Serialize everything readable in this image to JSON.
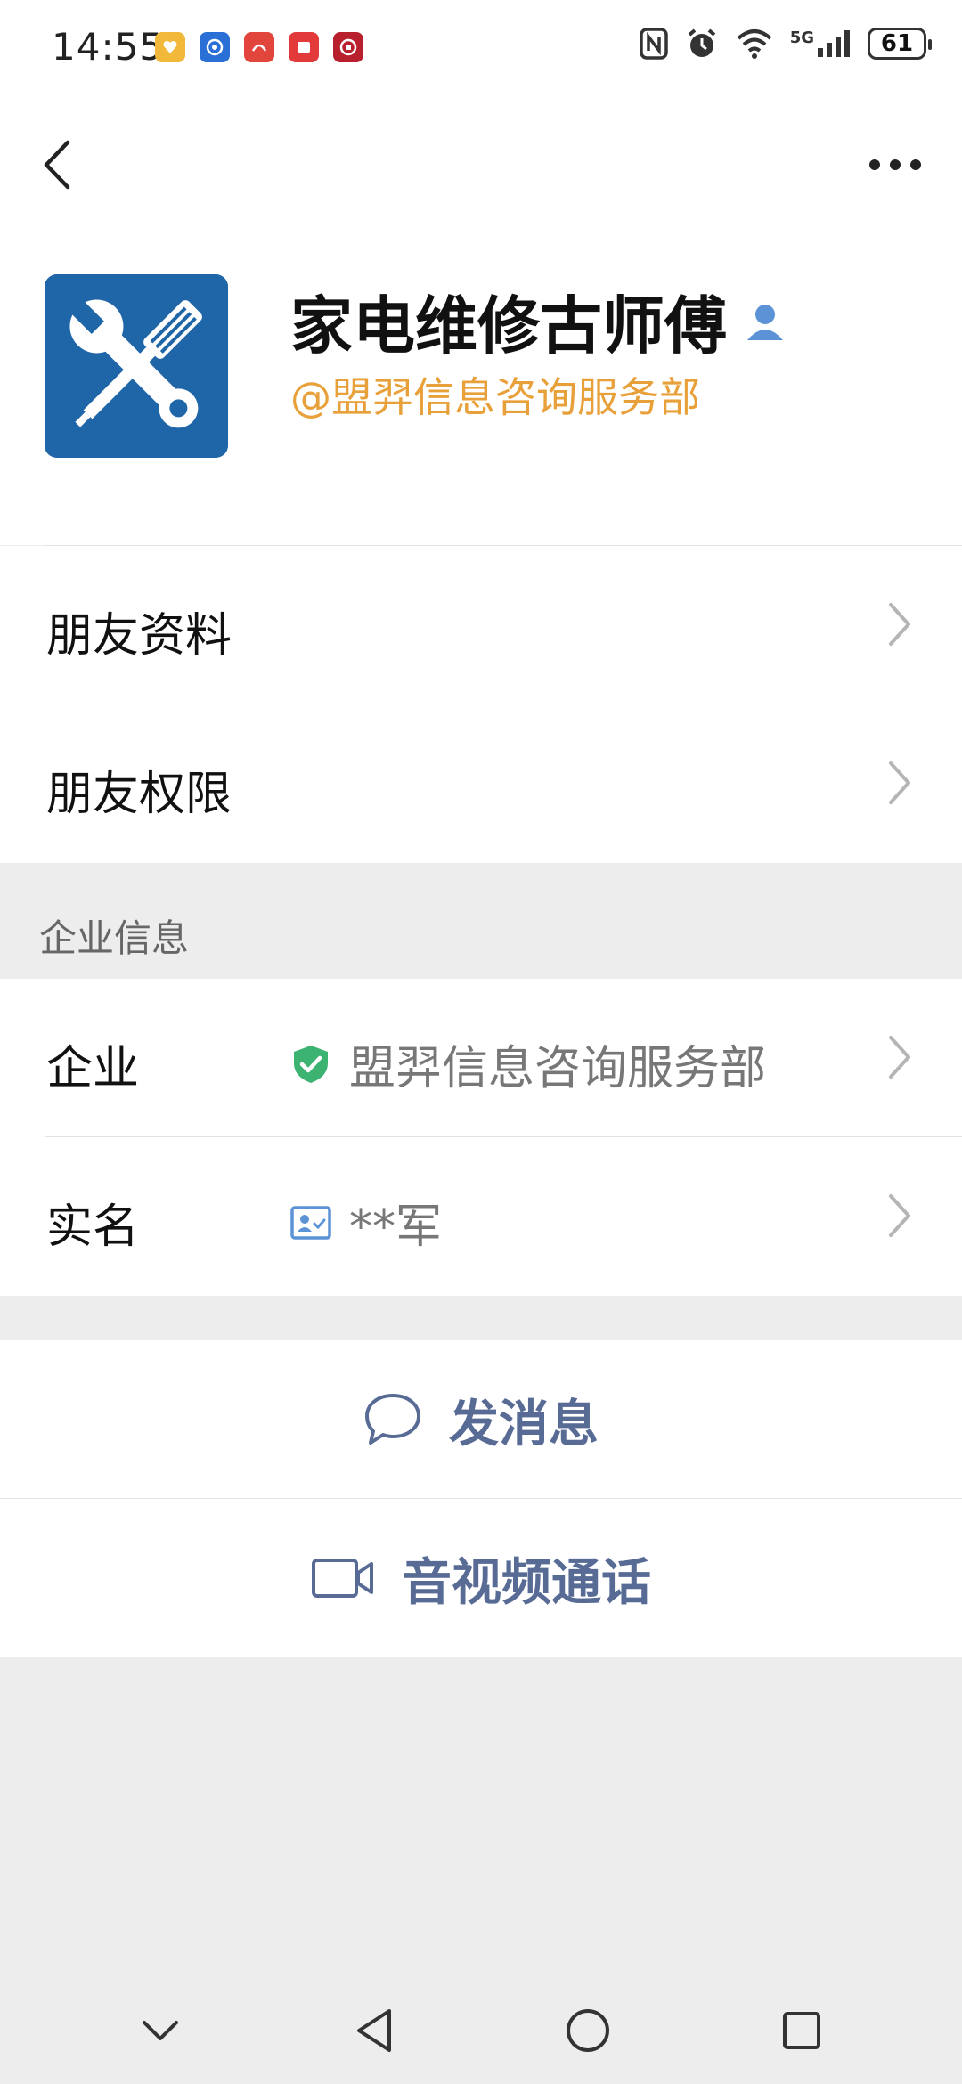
{
  "status_bar": {
    "time": "14:55",
    "battery": "61",
    "network": "5G"
  },
  "profile": {
    "name": "家电维修古师傅",
    "org_tag": "@盟羿信息咨询服务部"
  },
  "rows": {
    "friend_profile": "朋友资料",
    "friend_permissions": "朋友权限"
  },
  "enterprise_section": {
    "title": "企业信息",
    "enterprise_label": "企业",
    "enterprise_value": "盟羿信息咨询服务部",
    "realname_label": "实名",
    "realname_value": "**军"
  },
  "actions": {
    "send_message": "发消息",
    "video_call": "音视频通话"
  },
  "colors": {
    "accent_orange": "#e8a13a",
    "link_blue": "#576b95",
    "verified_green": "#3cb371",
    "background": "#ededed"
  },
  "icons": {
    "back": "chevron-left-icon",
    "more": "more-dots-icon",
    "person_badge": "person-icon",
    "shield": "shield-check-icon",
    "id_card": "id-card-icon",
    "chat": "chat-bubble-icon",
    "video": "video-camera-icon"
  }
}
